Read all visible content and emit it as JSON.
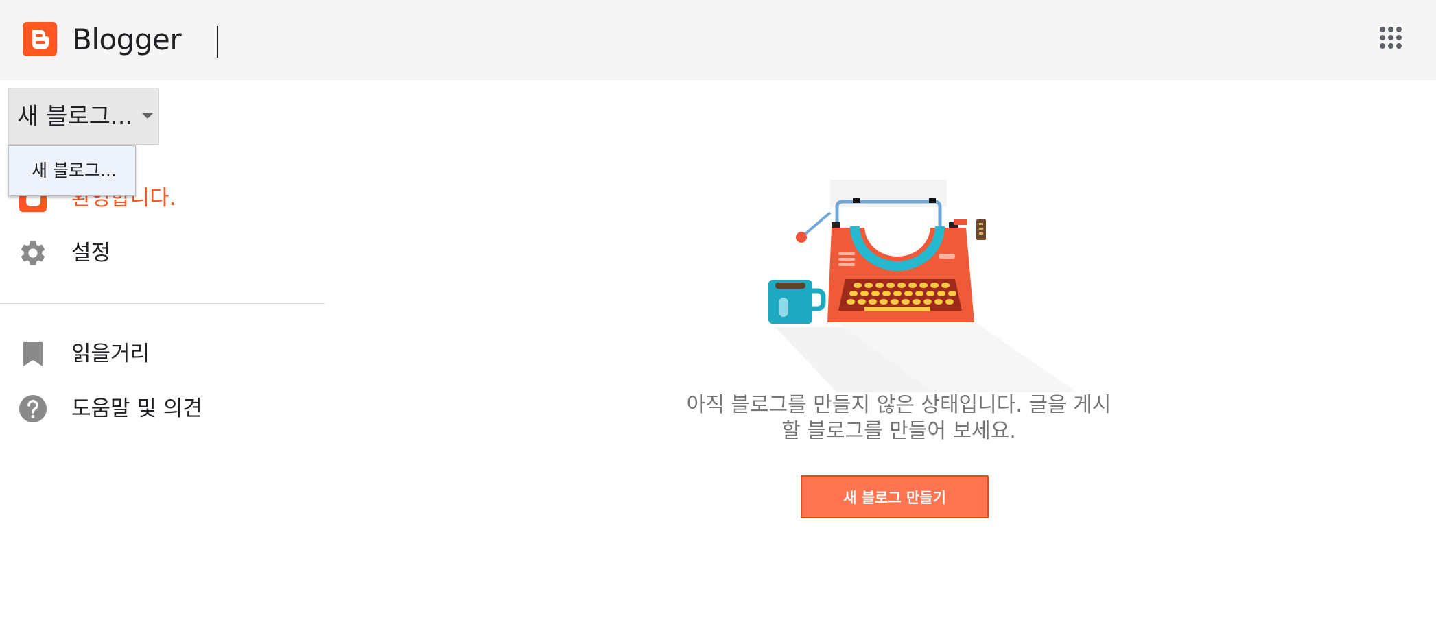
{
  "header": {
    "brand": "Blogger",
    "logo_icon": "blogger-logo-icon",
    "apps_icon": "apps-grid-icon",
    "brand_color": "#ff5722"
  },
  "blog_selector": {
    "selected": "새 블로그...",
    "options": [
      "새 블로그..."
    ]
  },
  "sidebar": {
    "items": [
      {
        "label": "환영합니다.",
        "icon": "blogger-icon",
        "active": true
      },
      {
        "label": "설정",
        "icon": "gear-icon",
        "active": false
      },
      {
        "label": "읽을거리",
        "icon": "bookmark-icon",
        "active": false
      },
      {
        "label": "도움말 및 의견",
        "icon": "help-icon",
        "active": false
      }
    ]
  },
  "main": {
    "empty_message_line1": "아직 블로그를 만들지 않은 상태입니다. 글을 게시",
    "empty_message_line2": "할 블로그를 만들어 보세요.",
    "create_button_label": "새 블로그 만들기",
    "illustration": "typewriter-illustration"
  },
  "colors": {
    "accent": "#ff5722",
    "button_bg": "#ff7552",
    "header_bg": "#f5f5f5"
  }
}
